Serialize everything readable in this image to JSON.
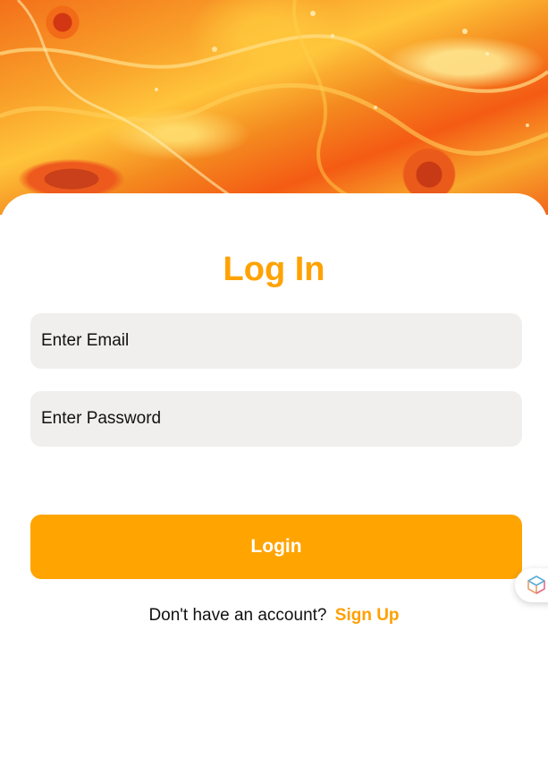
{
  "header": {
    "image": "orange-fluid-art-background"
  },
  "login": {
    "title": "Log In",
    "email_placeholder": "Enter Email",
    "password_placeholder": "Enter Password",
    "login_label": "Login",
    "signup_prompt": "Don't have an account?",
    "signup_label": "Sign Up"
  },
  "widget": {
    "icon": "cube-stack-icon"
  },
  "colors": {
    "accent": "#ffa400",
    "field_background": "#f0efee"
  }
}
